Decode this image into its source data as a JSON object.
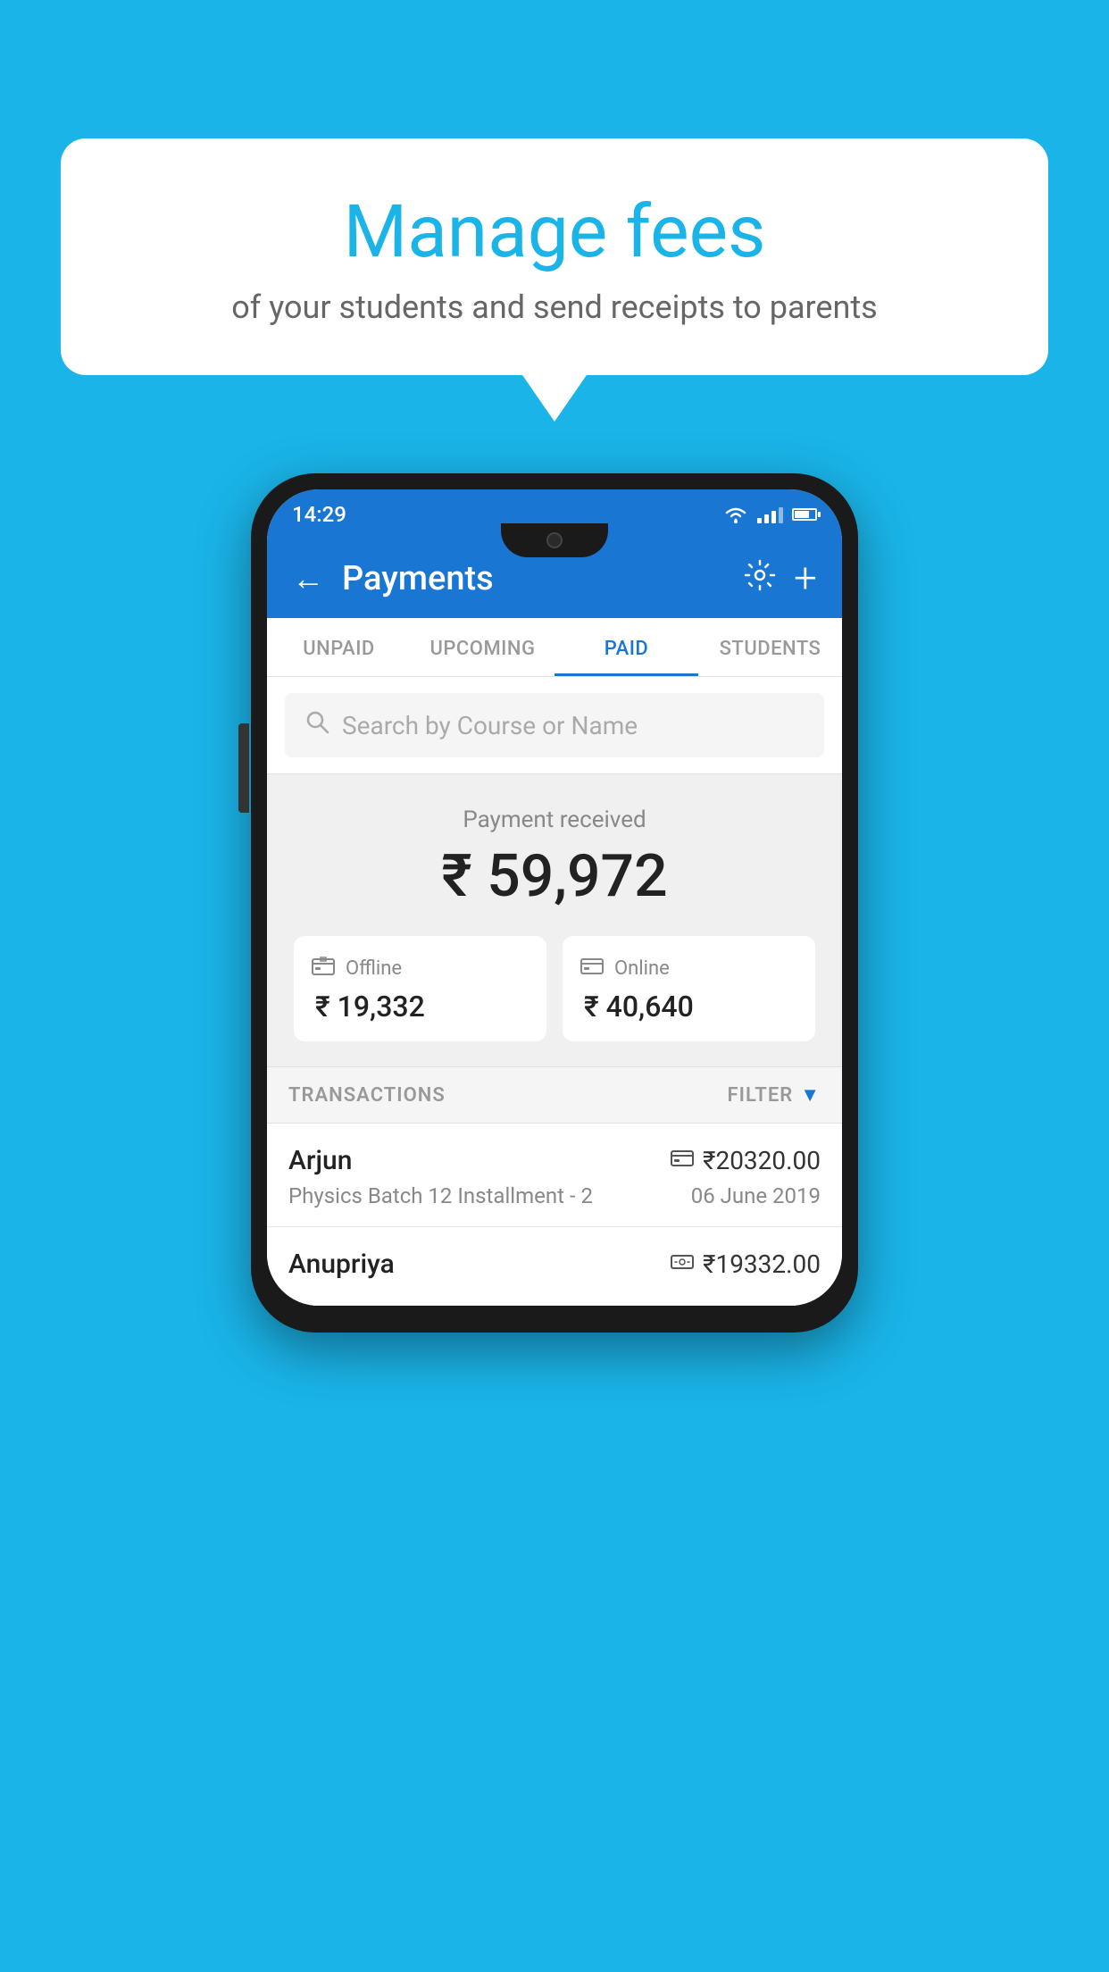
{
  "page": {
    "background_color": "#1ab4e8"
  },
  "bubble": {
    "title": "Manage fees",
    "subtitle": "of your students and send receipts to parents"
  },
  "status_bar": {
    "time": "14:29"
  },
  "app_bar": {
    "title": "Payments",
    "back_label": "←",
    "settings_label": "⚙",
    "add_label": "+"
  },
  "tabs": [
    {
      "label": "UNPAID",
      "active": false
    },
    {
      "label": "UPCOMING",
      "active": false
    },
    {
      "label": "PAID",
      "active": true
    },
    {
      "label": "STUDENTS",
      "active": false
    }
  ],
  "search": {
    "placeholder": "Search by Course or Name"
  },
  "payment_summary": {
    "label": "Payment received",
    "total": "₹ 59,972",
    "offline_label": "Offline",
    "offline_amount": "₹ 19,332",
    "online_label": "Online",
    "online_amount": "₹ 40,640"
  },
  "transactions": {
    "section_label": "TRANSACTIONS",
    "filter_label": "FILTER",
    "rows": [
      {
        "name": "Arjun",
        "course": "Physics Batch 12 Installment - 2",
        "amount": "₹20320.00",
        "date": "06 June 2019",
        "payment_type": "card"
      },
      {
        "name": "Anupriya",
        "course": "",
        "amount": "₹19332.00",
        "date": "",
        "payment_type": "cash"
      }
    ]
  }
}
